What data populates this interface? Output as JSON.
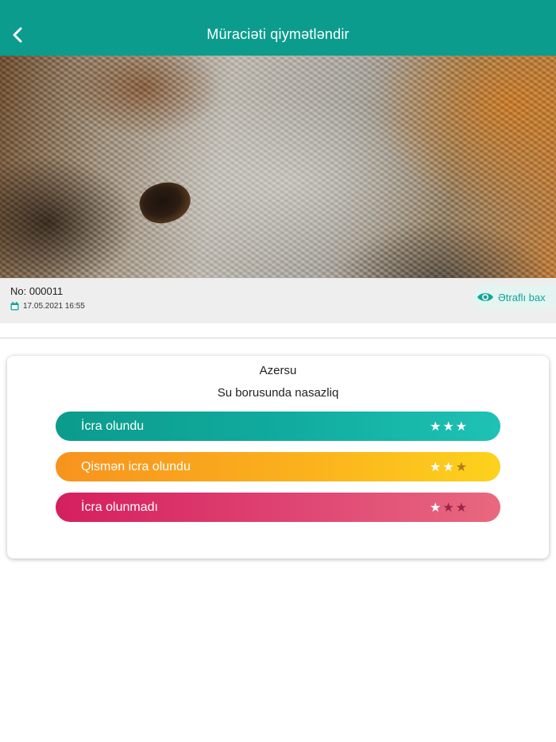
{
  "header": {
    "title": "Müraciəti qiymətləndir",
    "back_icon": "chevron-left-icon",
    "background": "#0b9c8d"
  },
  "photo": {
    "icon": "pipe-photo"
  },
  "ticket": {
    "number": "No: 000011",
    "date": "17.05.2021 16:55",
    "date_icon": "calendar-icon",
    "details_label": "Ətraflı bax",
    "details_icon": "eye-icon"
  },
  "card": {
    "company": "Azersu",
    "subject": "Su borusunda nasazliq",
    "options": [
      {
        "label": "İcra olundu",
        "stars": 3,
        "max_stars": 3,
        "color": "#0fa797"
      },
      {
        "label": "Qismən icra olundu",
        "stars": 2,
        "max_stars": 3,
        "color": "#fbb11d"
      },
      {
        "label": "İcra olunmadı",
        "stars": 1,
        "max_stars": 3,
        "color": "#dc3f6e"
      }
    ]
  }
}
